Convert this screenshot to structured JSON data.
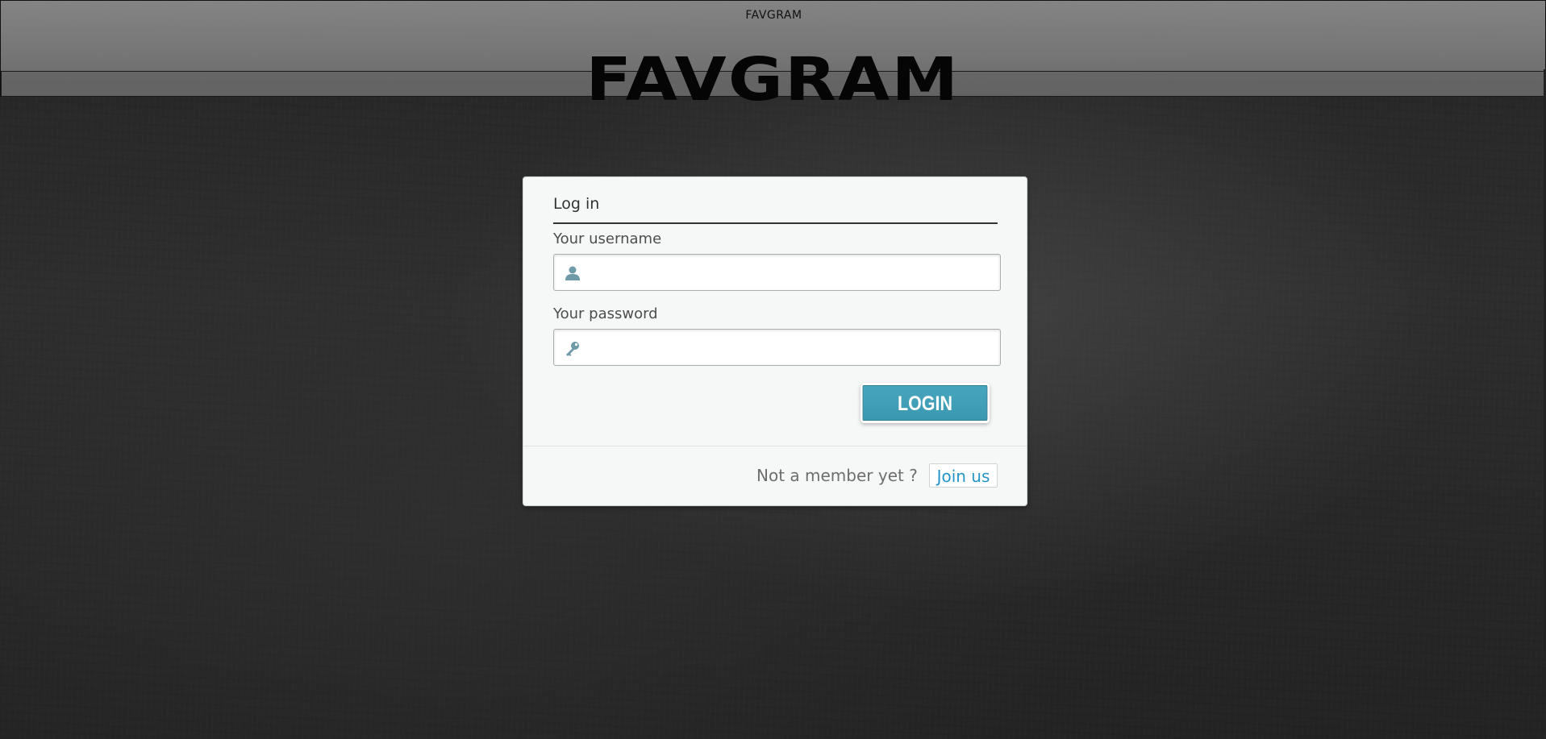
{
  "header": {
    "site_name": "FAVGRAM",
    "logo_text": "FAVGRAM"
  },
  "login_card": {
    "title": "Log in",
    "username": {
      "label": "Your username",
      "value": "",
      "placeholder": "",
      "icon": "user-icon"
    },
    "password": {
      "label": "Your password",
      "value": "",
      "placeholder": "",
      "icon": "key-icon"
    },
    "login_button_label": "LOGIN",
    "footer": {
      "prompt_text": "Not a member yet ?",
      "join_label": "Join us"
    }
  },
  "colors": {
    "accent": "#3a98b0",
    "link": "#2595c7",
    "card_background": "#f6f7f7"
  }
}
